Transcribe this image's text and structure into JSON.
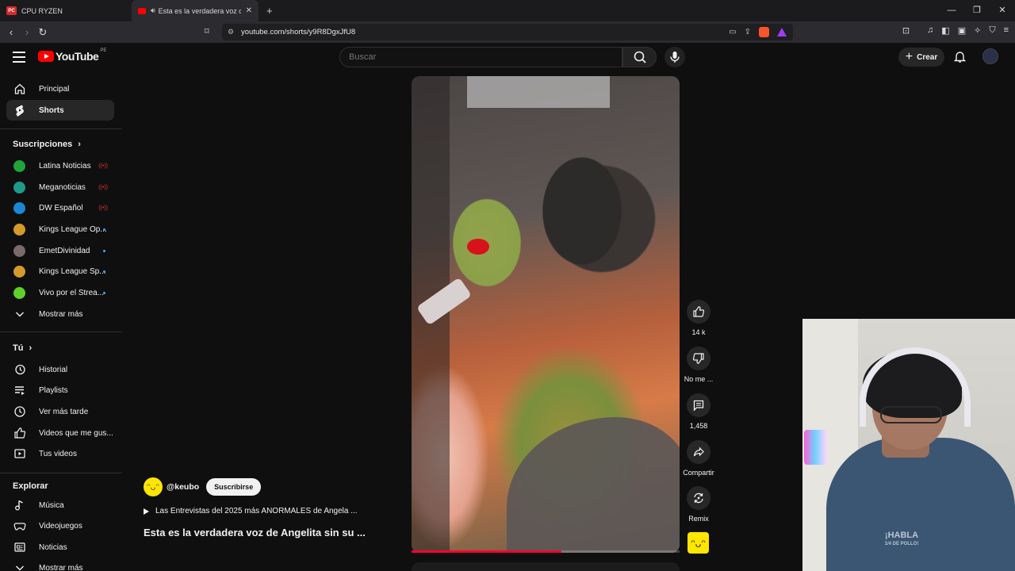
{
  "browser": {
    "tabs": [
      {
        "label": "CPU RYZEN",
        "favicon": "PC"
      },
      {
        "label": "Esta es la verdadera voz de A",
        "playing": true
      }
    ],
    "url": "youtube.com/shorts/y9R8DgxJfU8"
  },
  "header": {
    "logo_text": "YouTube",
    "country_code": "PE",
    "search_placeholder": "Buscar",
    "create_label": "Crear"
  },
  "sidebar": {
    "main": [
      {
        "label": "Principal",
        "icon": "home-icon"
      },
      {
        "label": "Shorts",
        "icon": "shorts-icon",
        "active": true
      }
    ],
    "subscriptions_title": "Suscripciones",
    "subscriptions": [
      {
        "label": "Latina Noticias",
        "color": "#1fa33a",
        "status": "live"
      },
      {
        "label": "Meganoticias",
        "color": "#1e9a8a",
        "status": "live"
      },
      {
        "label": "DW Español",
        "color": "#1a87d9",
        "status": "live"
      },
      {
        "label": "Kings League Op...",
        "color": "#d49a2a",
        "status": "new"
      },
      {
        "label": "EmetDivinidad",
        "color": "#7a6a6a",
        "status": "new"
      },
      {
        "label": "Kings League Sp...",
        "color": "#d49a2a",
        "status": "new"
      },
      {
        "label": "Vivo por el Strea...",
        "color": "#5fd12a",
        "status": "new"
      }
    ],
    "show_more": "Mostrar más",
    "you_title": "Tú",
    "you": [
      {
        "label": "Historial",
        "icon": "history-icon"
      },
      {
        "label": "Playlists",
        "icon": "playlists-icon"
      },
      {
        "label": "Ver más tarde",
        "icon": "watch-later-icon"
      },
      {
        "label": "Videos que me gus...",
        "icon": "like-icon"
      },
      {
        "label": "Tus videos",
        "icon": "your-videos-icon"
      }
    ],
    "explore_title": "Explorar",
    "explore": [
      {
        "label": "Música",
        "icon": "music-icon"
      },
      {
        "label": "Videojuegos",
        "icon": "gaming-icon"
      },
      {
        "label": "Noticias",
        "icon": "news-icon"
      },
      {
        "label": "Mostrar más",
        "icon": "chevron-down-icon"
      }
    ]
  },
  "short": {
    "channel_handle": "@keubo",
    "subscribe_label": "Suscribirse",
    "playlist_title": "Las Entrevistas del 2025 más ANORMALES de Angela ...",
    "title": "Esta es la verdadera voz de Angelita sin su ...",
    "progress": 0.56,
    "actions": {
      "likes": "14 k",
      "dislike": "No me ...",
      "comments": "1,458",
      "share": "Compartir",
      "remix": "Remix"
    }
  },
  "webcam": {
    "shirt_text_line1": "¡HABLA",
    "shirt_text_line2": "1/4 DE POLLO!"
  },
  "colors": {
    "background": "#0f0f0f",
    "brand_red": "#ff0000",
    "live_red": "#e33333",
    "new_dot": "#3ea6ff"
  }
}
